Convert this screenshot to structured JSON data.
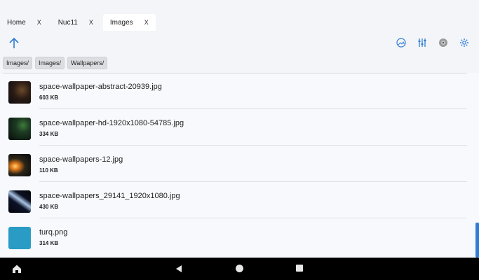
{
  "tabs": [
    {
      "label": "Home",
      "close": "X"
    },
    {
      "label": "Nuc11",
      "close": "X"
    },
    {
      "label": "Images",
      "close": "X"
    }
  ],
  "toolbar": {
    "up_icon": "arrow-up-icon",
    "icons": [
      "image-icon",
      "sliders-icon",
      "disc-icon",
      "gear-icon"
    ]
  },
  "breadcrumb": [
    "Images/",
    "Images/",
    "Wallpapers/"
  ],
  "files": [
    {
      "name": "space-wallpaper-abstract-20939.jpg",
      "size": "603 KB",
      "thumb": "dark-nebula"
    },
    {
      "name": "space-wallpaper-hd-1920x1080-54785.jpg",
      "size": "334 KB",
      "thumb": "green-planet"
    },
    {
      "name": "space-wallpapers-12.jpg",
      "size": "110 KB",
      "thumb": "sunrise-planet"
    },
    {
      "name": "space-wallpapers_29141_1920x1080.jpg",
      "size": "430 KB",
      "thumb": "comet"
    },
    {
      "name": "turq.png",
      "size": "314 KB",
      "thumb": "turquoise"
    }
  ],
  "scrollbar": {
    "position_fraction": 0.81
  },
  "colors": {
    "accent": "#2f7bd6",
    "background": "#f3f5f8",
    "nav_bar": "#000000"
  },
  "nav": {
    "home_icon": "home-icon",
    "back_icon": "back-triangle-icon",
    "home_circle_icon": "circle-icon",
    "recents_icon": "square-icon"
  }
}
